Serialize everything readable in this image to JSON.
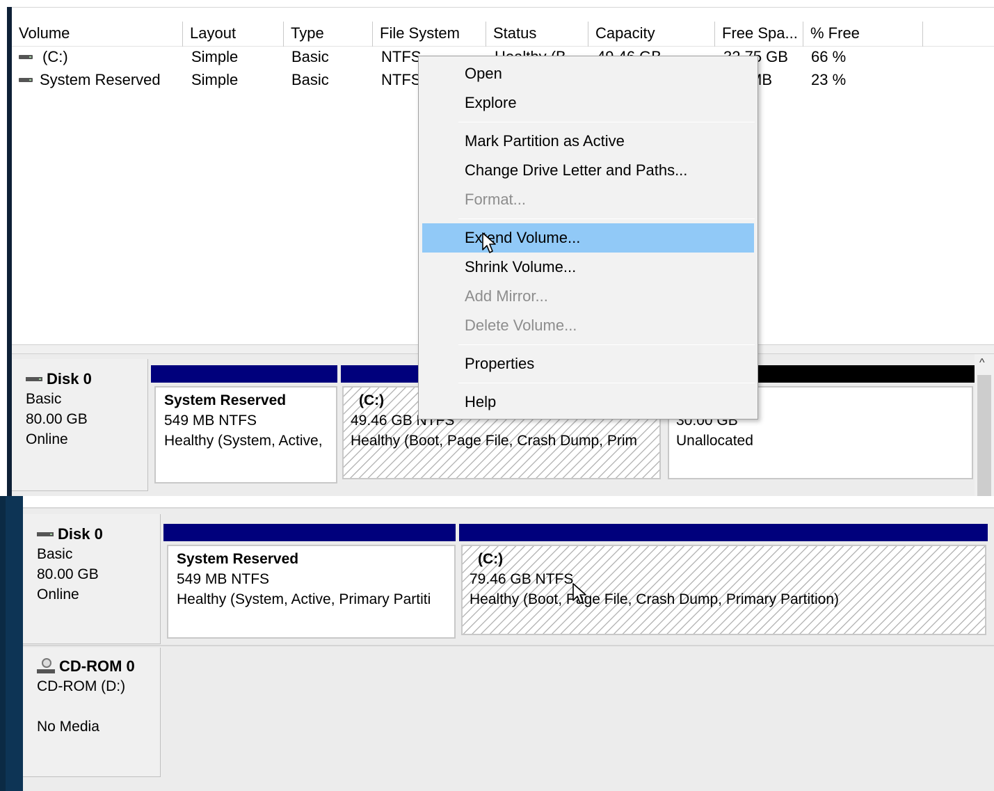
{
  "volume_list": {
    "columns": [
      "Volume",
      "Layout",
      "Type",
      "File System",
      "Status",
      "Capacity",
      "Free Spa...",
      "% Free"
    ],
    "rows": [
      {
        "volume": "(C:)",
        "layout": "Simple",
        "type": "Basic",
        "fs": "NTFS",
        "status": "Healthy (B",
        "capacity": "49.46 GB",
        "free": "32.75 GB",
        "pct_free": "66 %"
      },
      {
        "volume": "System Reserved",
        "layout": "Simple",
        "type": "Basic",
        "fs": "NTFS",
        "status": "",
        "capacity": "",
        "free": "MB",
        "pct_free": "23 %"
      }
    ]
  },
  "context_menu": {
    "items": [
      "Open",
      "Explore",
      "Mark Partition as Active",
      "Change Drive Letter and Paths...",
      "Format...",
      "Extend Volume...",
      "Shrink Volume...",
      "Add Mirror...",
      "Delete Volume...",
      "Properties",
      "Help"
    ],
    "highlighted": "Extend Volume...",
    "disabled": [
      "Format...",
      "Add Mirror...",
      "Delete Volume..."
    ]
  },
  "before": {
    "disk": {
      "name": "Disk 0",
      "type": "Basic",
      "size": "80.00 GB",
      "state": "Online"
    },
    "partitions": [
      {
        "title": "System Reserved",
        "size": "549 MB NTFS",
        "status": "Healthy (System, Active,"
      },
      {
        "title": "(C:)",
        "size": "49.46 GB NTFS",
        "status": "Healthy (Boot, Page File, Crash Dump, Prim"
      },
      {
        "title": "",
        "size": "30.00 GB",
        "status": "Unallocated"
      }
    ]
  },
  "after": {
    "disk": {
      "name": "Disk 0",
      "type": "Basic",
      "size": "80.00 GB",
      "state": "Online"
    },
    "partitions": [
      {
        "title": "System Reserved",
        "size": "549 MB NTFS",
        "status": "Healthy (System, Active, Primary Partiti"
      },
      {
        "title": "(C:)",
        "size": "79.46 GB NTFS",
        "status": "Healthy (Boot, Page File, Crash Dump, Primary Partition)"
      }
    ],
    "cdrom": {
      "name": "CD-ROM 0",
      "drive": "CD-ROM (D:)",
      "media": "No Media"
    }
  },
  "colors": {
    "partition_header": "#00007c",
    "unallocated_header": "#000000",
    "menu_highlight": "#91c9f7"
  }
}
